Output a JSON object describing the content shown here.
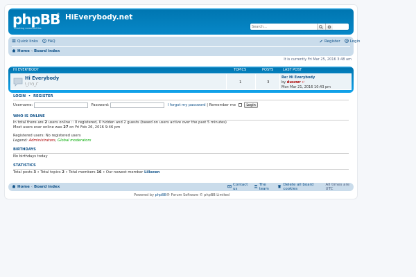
{
  "header": {
    "logo_text": "phpBB",
    "logo_tagline": "Creating communities",
    "site_name": "HiEverybody.net",
    "search_placeholder": "Search..."
  },
  "navbar": {
    "quick_links": "Quick links",
    "faq": "FAQ",
    "register": "Register",
    "login": "Login",
    "breadcrumbs": [
      "Home",
      "Board index"
    ]
  },
  "time_line": "It is currently Fri Mar 25, 2016 3:48 am",
  "forum_table": {
    "category": "HI EVERYBODY",
    "col_topics": "TOPICS",
    "col_posts": "POSTS",
    "col_last": "LAST POST",
    "forum": {
      "title": "Hi Everybody",
      "description": "\\_(ツ)_/¯",
      "topics": "1",
      "posts": "3",
      "last_post_title": "Re: Hi Everybody",
      "last_post_by_prefix": "by",
      "last_post_author": "duszwr",
      "last_post_time": "Mon Mar 21, 2016 10:43 pm"
    }
  },
  "login_box": {
    "heading_login": "LOGIN",
    "sep": "•",
    "heading_register": "REGISTER",
    "username_label": "Username:",
    "password_label": "Password:",
    "forgot": "I forgot my password",
    "pipe": "|",
    "remember": "Remember me",
    "button": "Login"
  },
  "who_online": {
    "heading": "WHO IS ONLINE",
    "line1_pre": "In total there are",
    "line1_count": "2",
    "line1_post": "users online :: 0 registered, 0 hidden and 2 guests (based on users active over the past 5 minutes)",
    "line2_pre": "Most users ever online was",
    "line2_count": "27",
    "line2_post": "on Fri Feb 26, 2016 9:46 pm",
    "registered": "Registered users: No registered users",
    "legend_label": "Legend:",
    "legend_admins": "Administrators",
    "legend_comma": ",",
    "legend_mods": "Global moderators"
  },
  "birthdays": {
    "heading": "BIRTHDAYS",
    "text": "No birthdays today"
  },
  "statistics": {
    "heading": "STATISTICS",
    "t1": "Total posts",
    "v1": "3",
    "bullet": "•",
    "t2": "Total topics",
    "v2": "2",
    "t3": "Total members",
    "v3": "16",
    "t4": "Our newest member",
    "v4": "Lillecen"
  },
  "footer_nav": {
    "contact": "Contact us",
    "team": "The team",
    "cookies": "Delete all board cookies",
    "tz": "All times are UTC"
  },
  "footer": {
    "pre": "Powered by",
    "phpbb": "phpBB",
    "post": "® Forum Software © phpBB Limited"
  },
  "colors": {
    "header_blue": "#12a3eb",
    "nav_bg": "#cadceb",
    "link": "#105289"
  }
}
